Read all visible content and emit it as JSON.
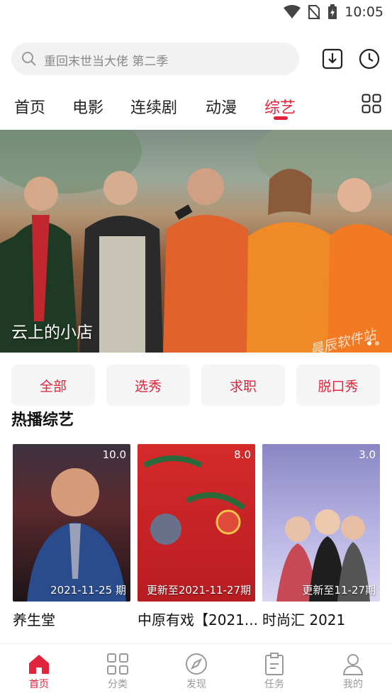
{
  "status": {
    "time": "10:05"
  },
  "search": {
    "placeholder": "重回末世当大佬 第二季"
  },
  "tabs": [
    {
      "label": "首页",
      "active": false
    },
    {
      "label": "电影",
      "active": false
    },
    {
      "label": "连续剧",
      "active": false
    },
    {
      "label": "动漫",
      "active": false
    },
    {
      "label": "综艺",
      "active": true
    }
  ],
  "banner": {
    "caption": "云上的小店",
    "watermark": "晨辰软件站"
  },
  "chips": [
    "全部",
    "选秀",
    "求职",
    "脱口秀"
  ],
  "section_title": "热播综艺",
  "cards": [
    {
      "title": "养生堂",
      "score": "10.0",
      "meta": "2021-11-25 期"
    },
    {
      "title": "中原有戏【2021...",
      "score": "8.0",
      "meta": "更新至2021-11-27期"
    },
    {
      "title": "时尚汇 2021",
      "score": "3.0",
      "meta": "更新至11-27期"
    }
  ],
  "bottom_nav": [
    {
      "label": "首页",
      "icon": "home-icon",
      "active": true
    },
    {
      "label": "分类",
      "icon": "grid-icon",
      "active": false
    },
    {
      "label": "发现",
      "icon": "compass-icon",
      "active": false
    },
    {
      "label": "任务",
      "icon": "clipboard-icon",
      "active": false
    },
    {
      "label": "我的",
      "icon": "user-icon",
      "active": false
    }
  ],
  "colors": {
    "accent": "#e1233b"
  }
}
